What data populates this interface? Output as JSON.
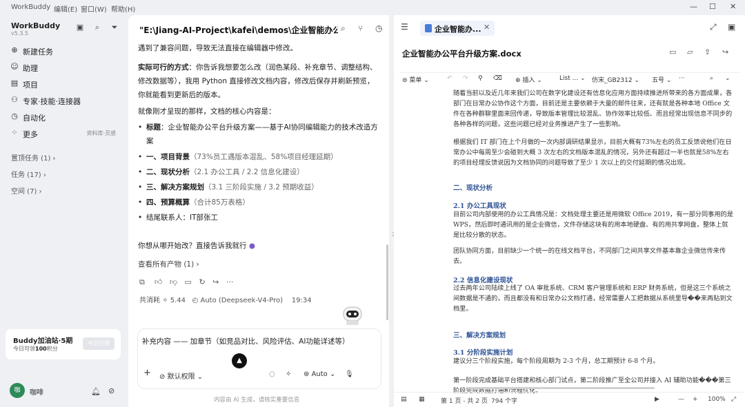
{
  "titlebar": {
    "app": "WorkBuddy",
    "menus": [
      "编辑(E)",
      "窗口(W)",
      "帮助(H)"
    ],
    "controls": [
      "—",
      "☐",
      "✕"
    ]
  },
  "sidebar": {
    "brand": "WorkBuddy",
    "version": "v5.3.5",
    "items": [
      {
        "icon": "plus-icon",
        "label": "新建任务"
      },
      {
        "icon": "assistant-icon",
        "label": "助理"
      },
      {
        "icon": "project-icon",
        "label": "项目"
      },
      {
        "icon": "expert-icon",
        "label": "专家·技能·连接器"
      },
      {
        "icon": "automation-icon",
        "label": "自动化"
      },
      {
        "icon": "more-icon",
        "label": "更多",
        "aux": "资料库·灵感"
      }
    ],
    "groups": [
      "置顶任务 (1)",
      "任务 (17)",
      "空间 (7)"
    ],
    "promo": {
      "title": "Buddy加油站·5期",
      "subtitle_prefix": "今日可领",
      "subtitle_value": "100",
      "subtitle_suffix": "积分",
      "button": "今日已领"
    },
    "user": {
      "avatar": "咖",
      "name": "咖啡"
    }
  },
  "chat": {
    "title": "\"E:\\Jiang-AI-Project\\kafei\\demos\\企业智能办公平台升",
    "p1": "遇到了兼容问题，导致无法直接在编辑器中修改。",
    "p2_bold": "实际可行的方式",
    "p2_rest": "：你告诉我想要怎么改（润色某段、补充章节、调整结构、修改数据等），我用 Python 直接修改文档内容，修改后保存并刷新预览，你就能看到更新后的版本。",
    "p3": "就像刚才呈现的那样，文档的核心内容是：",
    "bullets": [
      {
        "bold": "标题",
        "rest": "：企业智能办公平台升级方案——基于AI协同编辑能力的技术改造方案"
      },
      {
        "bold": "一、项目背景",
        "rest": "（73%员工遇版本混乱、58%项目经理延期）"
      },
      {
        "bold": "二、现状分析",
        "rest": "（2.1 办公工具 / 2.2 信息化建设）"
      },
      {
        "bold": "三、解决方案规划",
        "rest": "（3.1 三阶段实施 / 3.2 预期收益）"
      },
      {
        "bold": "四、预算概算",
        "rest": "（合计85万表格）"
      },
      {
        "bold": "",
        "rest": "结尾联系人：IT部张工"
      }
    ],
    "question": "你想从哪开始改？直接告诉我就行",
    "artifacts": "查看所有产物 (1)",
    "meta": {
      "consume": "共消耗 ✧ 5.44",
      "model": "Auto (Deepseek-V4-Pro)",
      "time": "19:34"
    },
    "composer_text": "补充内容 —— 加章节（如竞品对比、风险评估、AI功能详述等）",
    "permission": "默认权限",
    "mode": "Auto",
    "disclaimer": "内容由 AI 生成，请核实重要信息"
  },
  "doc": {
    "tab": "企业智能办...",
    "filename": "企业智能办公平台升级方案.docx",
    "outline_tab": "大纲",
    "toolbar": {
      "menu": "菜单",
      "insert": "插入",
      "list": "List ...",
      "font": "仿宋_GB2312",
      "size": "五号",
      "more": "···"
    },
    "body": {
      "p_intro": "随着当前以及近几年来我们公司在数字化建设还有信息化应用方面持续推进所带来的各方面成果，各部门在日常办公协作这个方面，目前还是主要依赖于大量的邮件往来，还有就是各种本地 Office 文件在各种群聊里面来回传递，导致版本管理比较混乱、协作效率比较低、而且经常出现信息不同步的各种各样的问题，这些问题已经对业务推进产生了一些影响。",
      "p_survey": "根据我们 IT 部门在上个月做的一次内部调研结果显示，目前大概有73%左右的员工反馈说他们在日常办公中每周至少会碰到大概 3 次左右的文档版本混乱的情况，另外还有超过一半也就是58%左右的项目经理反馈说因为文档协同的问题导致了至少 1 次以上的交付延期的情况出现。",
      "h2": "二、现状分析",
      "h21": "2.1 办公工具现状",
      "p21a": "目前公司内部使用的办公工具情况是：文档处理主要还是用微软 Office 2019，有一部分同事用的是 WPS，然后即时通讯用的是企业微信，文件存储这块有的用本地硬盘、有的用共享网盘，整体上就是比较分散的状态。",
      "p21b": "团队协同方面，目前缺少一个统一的在线文档平台，不同部门之间共享文件基本靠企业微信传来传去。",
      "h22": "2.2 信息化建设现状",
      "p22": "过去两年公司陆续上线了 OA 审批系统、CRM 客户管理系统和 ERP 财务系统，但是这三个系统之间数据是不通的，而且都没有和日常办公文档打通，经常需要人工把数据从系统里导��来再贴到文档里。",
      "h3": "三、解决方案规划",
      "h31": "3.1 分阶段实施计划",
      "p31a": "建议分三个阶段实施，每个阶段周期为 2-3 个月，总工期预计 6-8 个月。",
      "p31b": "第一阶段完成基础平台搭建和核心部门试点，第二阶段推广至全公司并接入 AI 辅助功能���第三阶段完成数据打通和流程优化。"
    },
    "status": {
      "page": "第 1 页 - 共 2 页",
      "words": "794 个字",
      "zoom": "100%"
    }
  }
}
